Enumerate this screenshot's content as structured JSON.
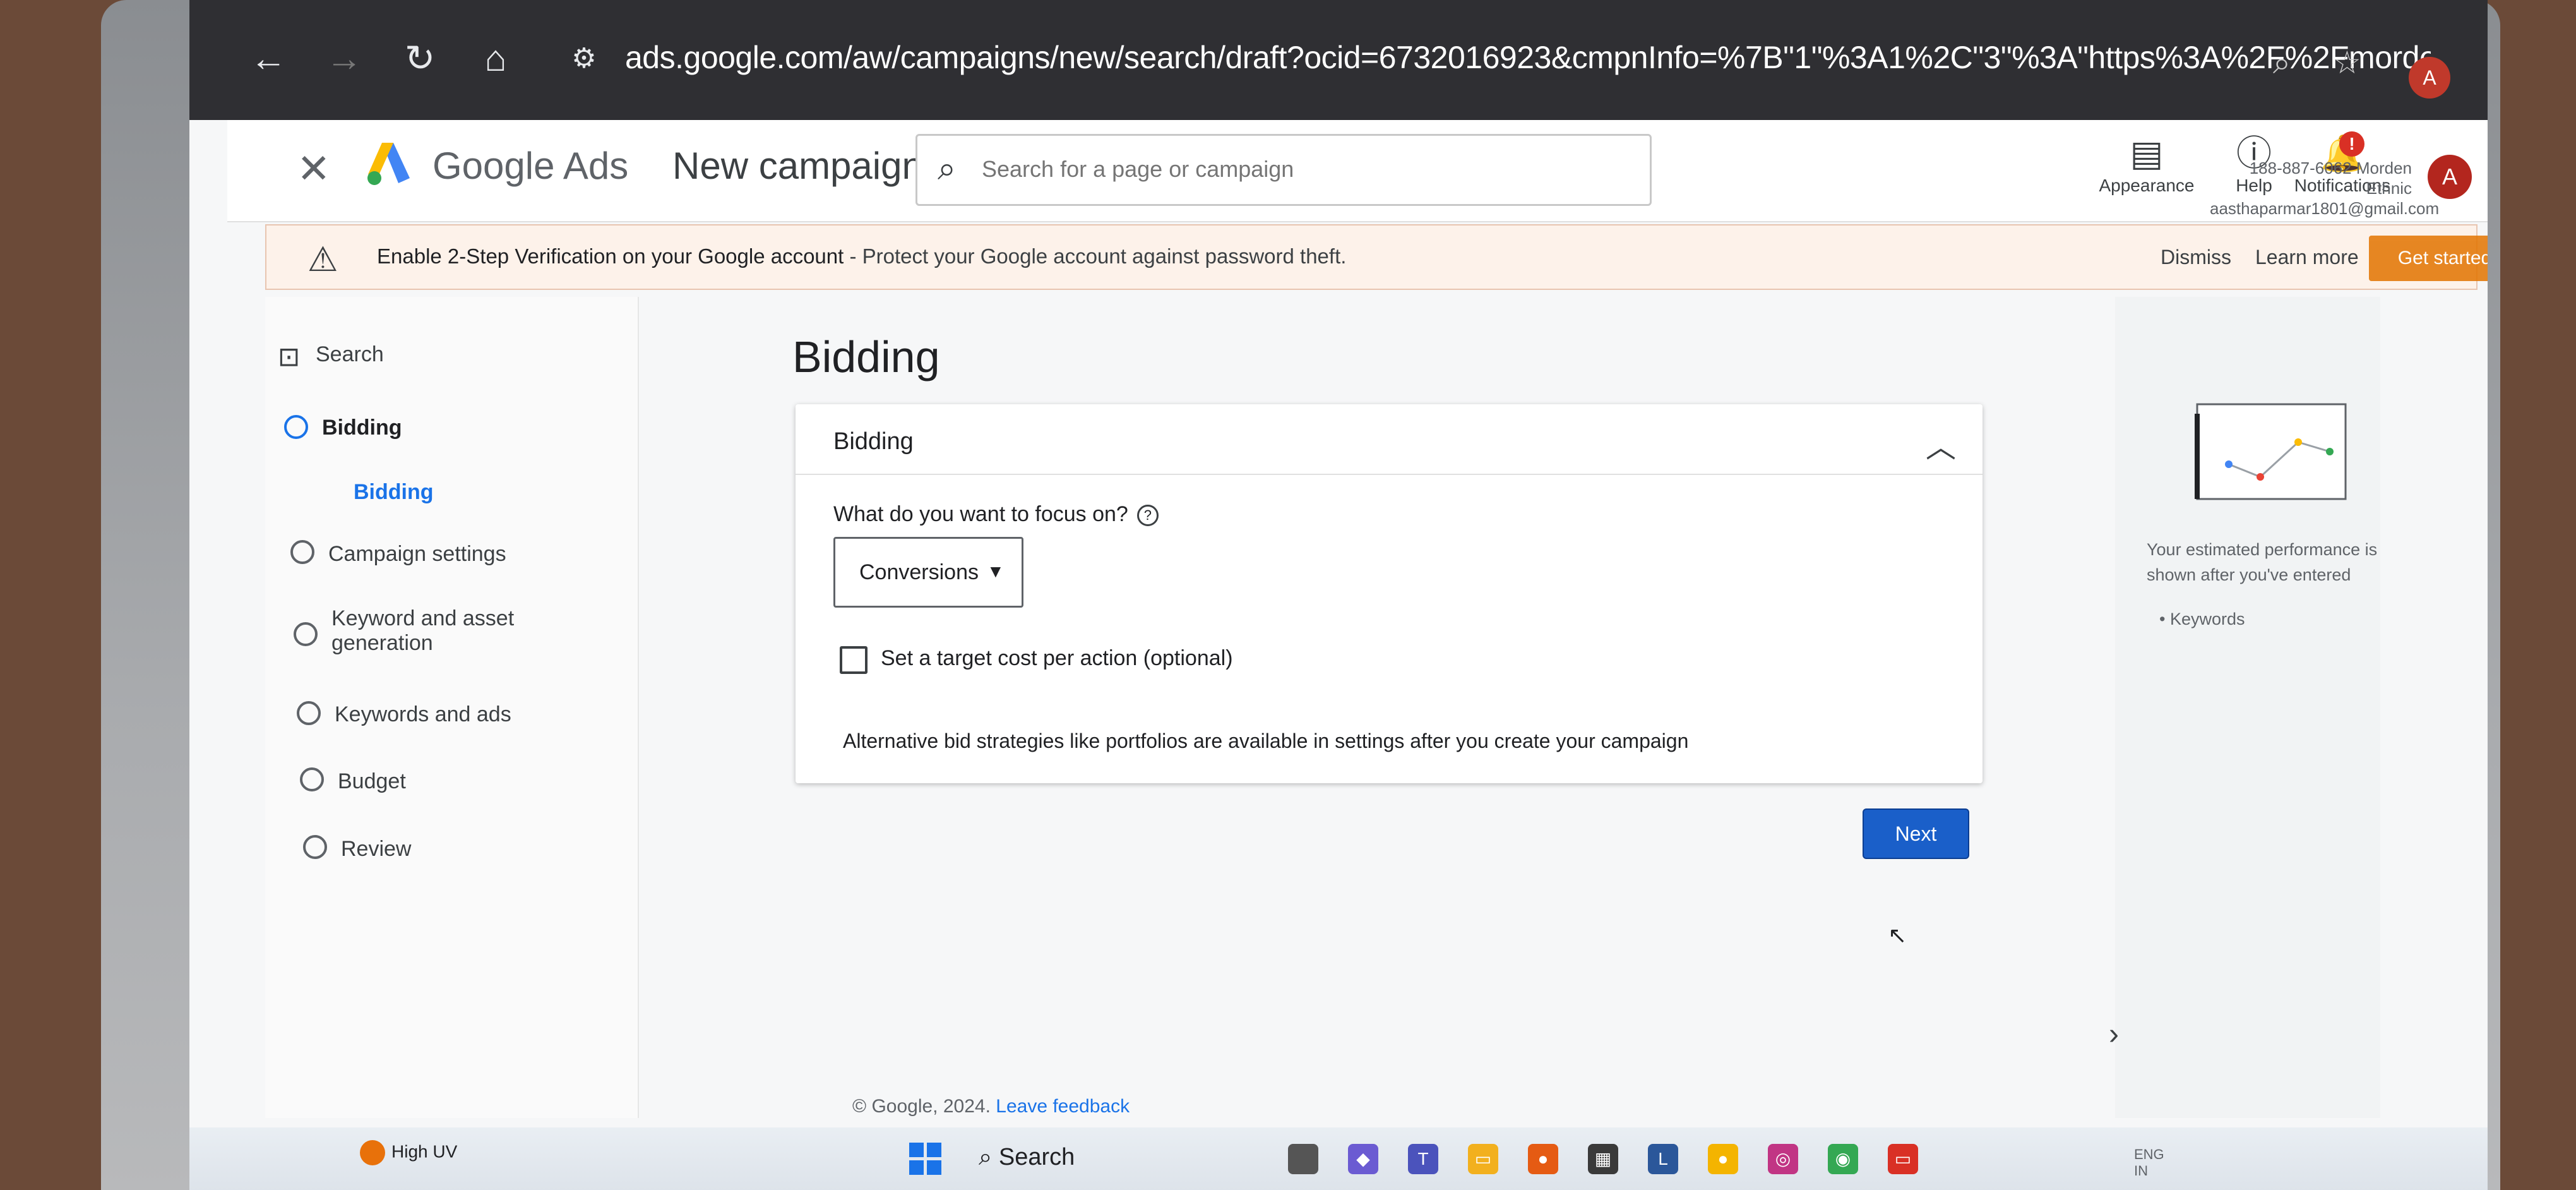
{
  "browser": {
    "url": "ads.google.com/aw/campaigns/new/search/draft?ocid=6732016923&cmpnInfo=%7B\"1\"%3A1%2C\"3\"%3A\"https%3A%2F%2Fmorde...",
    "profile_initial": "A"
  },
  "header": {
    "brand": "Google Ads",
    "page_name": "New campaign",
    "search_placeholder": "Search for a page or campaign",
    "tools": {
      "appearance": "Appearance",
      "help": "Help",
      "notifications": "Notifications",
      "notification_badge": "!"
    },
    "account_line1": "188-887-6062 Morden Ethnic",
    "account_line2": "aasthaparmar1801@gmail.com",
    "avatar_initial": "A"
  },
  "banner": {
    "title": "Enable 2-Step Verification on your Google account",
    "text": " - Protect your Google account against password theft.",
    "dismiss": "Dismiss",
    "learn_more": "Learn more",
    "cta": "Get started"
  },
  "sidebar": {
    "search": "Search",
    "step_bidding": "Bidding",
    "sub_bidding": "Bidding",
    "campaign_settings": "Campaign settings",
    "keyword_asset_line1": "Keyword and asset",
    "keyword_asset_line2": "generation",
    "keywords_ads": "Keywords and ads",
    "budget": "Budget",
    "review": "Review"
  },
  "main": {
    "title": "Bidding",
    "card_title": "Bidding",
    "question": "What do you want to focus on?",
    "focus_value": "Conversions",
    "target_cpa_label": "Set a target cost per action (optional)",
    "target_cpa_checked": false,
    "alt_note": "Alternative bid strategies like portfolios are available in settings after you create your campaign",
    "next": "Next"
  },
  "right_panel": {
    "perf_text": "Your estimated performance is shown after you've entered",
    "bullet": "Keywords"
  },
  "footer": {
    "copyright": "© Google, 2024.",
    "feedback": "Leave feedback"
  },
  "taskbar": {
    "weather": "High UV",
    "search": "Search",
    "lang": "ENG",
    "region": "IN"
  }
}
